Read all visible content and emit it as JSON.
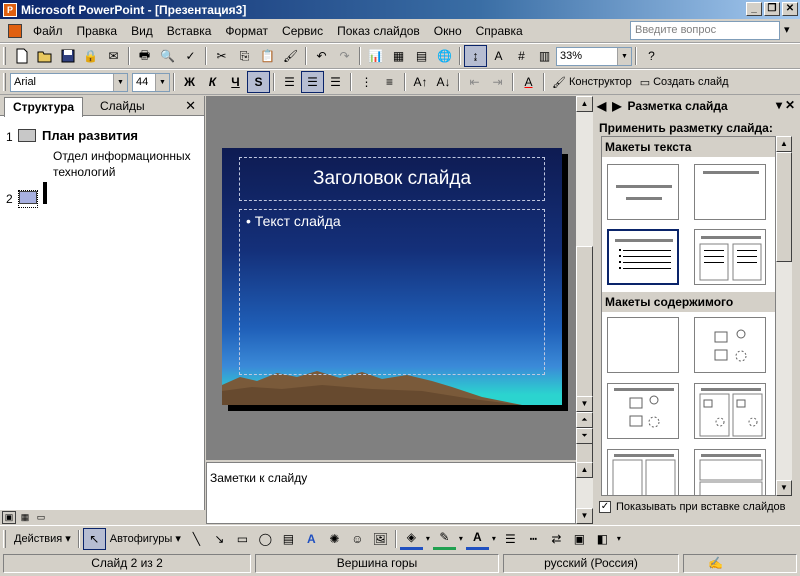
{
  "window": {
    "title": "Microsoft PowerPoint - [Презентация3]",
    "app_icon": "P"
  },
  "menu": {
    "items": [
      "Файл",
      "Правка",
      "Вид",
      "Вставка",
      "Формат",
      "Сервис",
      "Показ слайдов",
      "Окно",
      "Справка"
    ],
    "help_placeholder": "Введите вопрос"
  },
  "standard_toolbar": {
    "zoom": "33%"
  },
  "format_toolbar": {
    "font": "Arial",
    "size": "44",
    "bold": "Ж",
    "italic": "К",
    "underline": "Ч",
    "shadow": "S",
    "font_color_glyph": "A",
    "designer": "Конструктор",
    "new_slide": "Создать слайд"
  },
  "outline_pane": {
    "tabs": [
      "Структура",
      "Слайды"
    ],
    "close": "✕",
    "slides": [
      {
        "number": "1",
        "title": "План развития",
        "body": [
          "Отдел информационных",
          "технологий"
        ]
      },
      {
        "number": "2",
        "title": "",
        "body": []
      }
    ]
  },
  "slide": {
    "title_placeholder": "Заголовок слайда",
    "body_placeholder": "Текст слайда",
    "bullet": "•"
  },
  "notes": {
    "placeholder": "Заметки к слайду"
  },
  "task_pane": {
    "title": "Разметка слайда",
    "apply_label": "Применить разметку слайда:",
    "groups": [
      "Макеты текста",
      "Макеты содержимого"
    ],
    "show_on_insert": "Показывать при вставке слайдов",
    "show_on_insert_checked": true
  },
  "drawing_toolbar": {
    "actions": "Действия",
    "autoshapes": "Автофигуры",
    "font_color_glyph": "A"
  },
  "status_bar": {
    "slide_info": "Слайд 2 из 2",
    "design": "Вершина горы",
    "language": "русский (Россия)"
  },
  "colors": {
    "titlebar": "#0a246a",
    "slide_top": "#0e1b52",
    "slide_horizon": "#2bd4cf",
    "mountain": "#7a5a3a"
  }
}
